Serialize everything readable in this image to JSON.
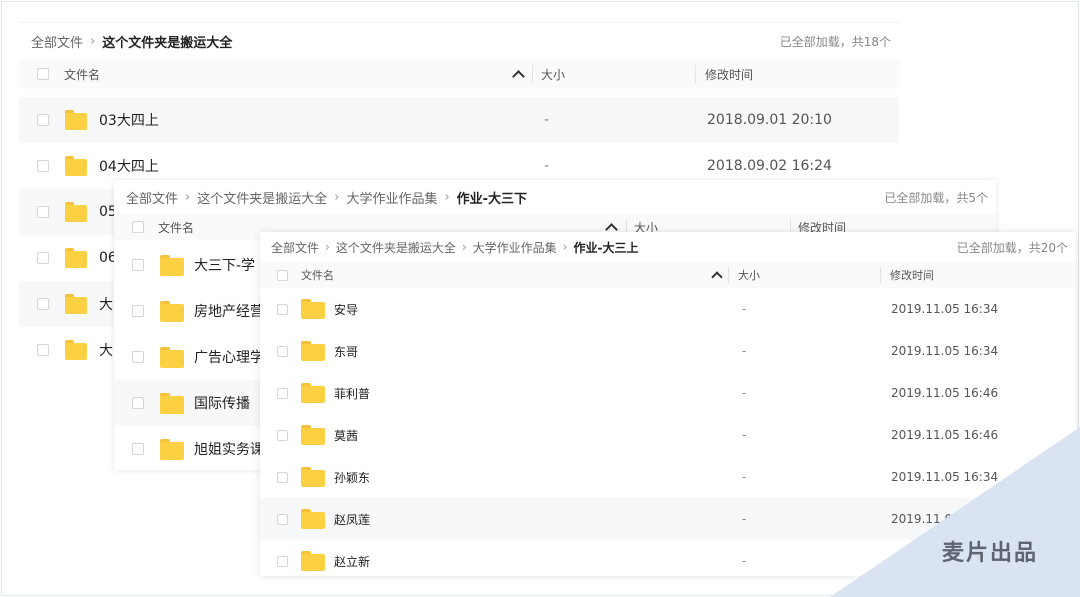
{
  "panel1": {
    "breadcrumb": [
      "全部文件",
      "这个文件夹是搬运大全"
    ],
    "count": "已全部加载，共18个",
    "header": {
      "name": "文件名",
      "size": "大小",
      "time": "修改时间"
    },
    "rows": [
      {
        "name": "03大四上",
        "size": "-",
        "time": "2018.09.01 20:10"
      },
      {
        "name": "04大四上",
        "size": "-",
        "time": "2018.09.02 16:24"
      },
      {
        "name": "05",
        "size": "",
        "time": ""
      },
      {
        "name": "06",
        "size": "",
        "time": ""
      },
      {
        "name": "大",
        "size": "",
        "time": ""
      },
      {
        "name": "大",
        "size": "",
        "time": ""
      }
    ]
  },
  "panel2": {
    "breadcrumb": [
      "全部文件",
      "这个文件夹是搬运大全",
      "大学作业作品集",
      "作业-大三下"
    ],
    "count": "已全部加载，共5个",
    "header": {
      "name": "文件名",
      "size": "大小",
      "time": "修改时间"
    },
    "rows": [
      {
        "name": "大三下-学"
      },
      {
        "name": "房地产经营"
      },
      {
        "name": "广告心理学"
      },
      {
        "name": "国际传播"
      },
      {
        "name": "旭姐实务课"
      }
    ]
  },
  "panel3": {
    "breadcrumb": [
      "全部文件",
      "这个文件夹是搬运大全",
      "大学作业作品集",
      "作业-大三上"
    ],
    "count": "已全部加载，共20个",
    "header": {
      "name": "文件名",
      "size": "大小",
      "time": "修改时间"
    },
    "rows": [
      {
        "name": "安导",
        "size": "-",
        "time": "2019.11.05 16:34"
      },
      {
        "name": "东哥",
        "size": "-",
        "time": "2019.11.05 16:34"
      },
      {
        "name": "菲利普",
        "size": "-",
        "time": "2019.11.05 16:46"
      },
      {
        "name": "莫茜",
        "size": "-",
        "time": "2019.11.05 16:46"
      },
      {
        "name": "孙颖东",
        "size": "-",
        "time": "2019.11.05 16:34"
      },
      {
        "name": "赵凤莲",
        "size": "-",
        "time": "2019.11.0"
      },
      {
        "name": "赵立新",
        "size": "-",
        "time": ""
      }
    ]
  },
  "watermark": {
    "text": "麦片出品",
    "color": "#d9e3f2"
  },
  "colors": {
    "folder": "#fbd043",
    "row_alt": "#f7f8fa"
  }
}
